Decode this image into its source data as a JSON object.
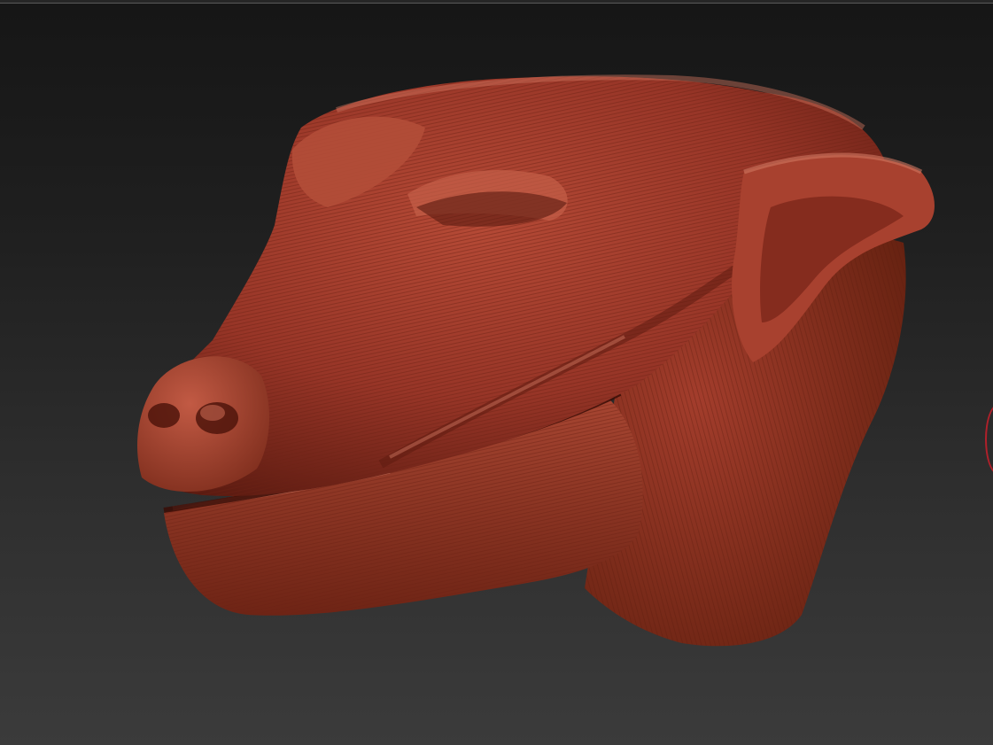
{
  "app": {
    "kind": "3d-sculpting-viewport"
  },
  "canvas": {
    "model": "sculpted-creature-head",
    "material_color": "#9c3b2c",
    "highlight_color": "#c8705c",
    "shadow_color": "#4e140c",
    "background_top": "#161616",
    "background_bottom": "#3b3b3b"
  },
  "brush": {
    "cursor_color": "#b0202a"
  }
}
